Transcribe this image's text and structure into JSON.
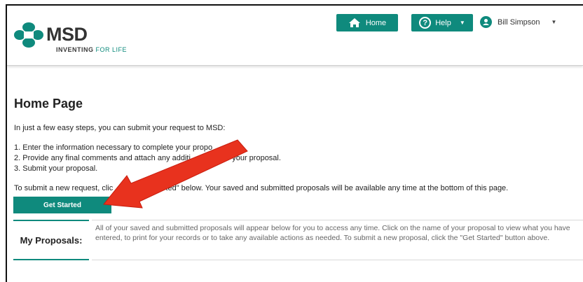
{
  "header": {
    "logo_text": "MSD",
    "logo_tagline_bold": "INVENTING",
    "logo_tagline_rest": " FOR LIFE",
    "home_label": "Home",
    "help_label": "Help",
    "user_name": "Bill Simpson",
    "brand_color": "#0f8a7d"
  },
  "main": {
    "title": "Home Page",
    "intro": "In just a few easy steps, you can submit your request to MSD:",
    "steps": [
      "1. Enter the information necessary to complete your propo",
      "2. Provide any final comments and attach any additi        files to your proposal.",
      "3. Submit your proposal."
    ],
    "note": "To submit a new request, clic              et Started\" below. Your saved and submitted proposals will be available any time at the bottom of this page.",
    "get_started_label": "Get Started",
    "proposals_label": "My Proposals:",
    "proposals_description": "All of your saved and submitted proposals will appear below for you to access any time. Click on the name of your proposal to view what you have entered, to print for your records or to take any available actions as needed. To submit a new proposal, click the \"Get Started\" button above."
  },
  "annotation": {
    "arrow_color": "#e8321e"
  }
}
